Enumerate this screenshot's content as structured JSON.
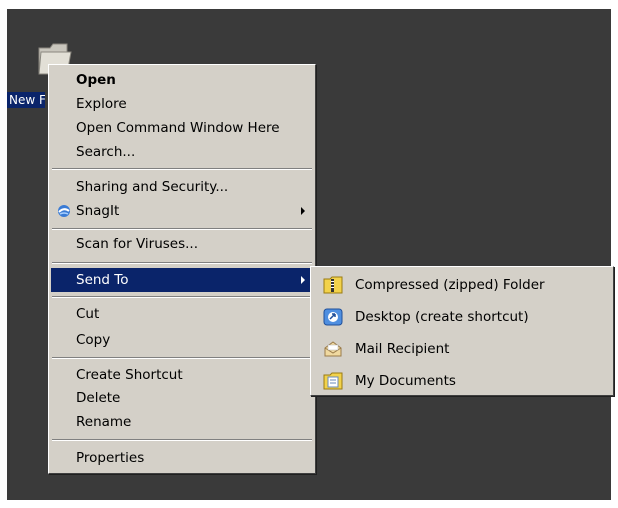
{
  "desktop": {
    "icon_label": "New Folder"
  },
  "context_menu": {
    "items": [
      {
        "label": "Open"
      },
      {
        "label": "Explore"
      },
      {
        "label": "Open Command Window Here"
      },
      {
        "label": "Search..."
      },
      {
        "label": "Sharing and Security..."
      },
      {
        "label": "SnagIt",
        "icon": "snagit-icon",
        "submenu": true
      },
      {
        "label": "Scan for Viruses..."
      },
      {
        "label": "Send To",
        "submenu": true,
        "selected": true
      },
      {
        "label": "Cut"
      },
      {
        "label": "Copy"
      },
      {
        "label": "Create Shortcut"
      },
      {
        "label": "Delete"
      },
      {
        "label": "Rename"
      },
      {
        "label": "Properties"
      }
    ]
  },
  "send_to_menu": {
    "items": [
      {
        "label": "Compressed (zipped) Folder",
        "icon": "zip-folder-icon"
      },
      {
        "label": "Desktop (create shortcut)",
        "icon": "desktop-shortcut-icon"
      },
      {
        "label": "Mail Recipient",
        "icon": "mail-icon"
      },
      {
        "label": "My Documents",
        "icon": "my-documents-icon"
      }
    ]
  },
  "colors": {
    "desktop": "#3a3a3a",
    "menu": "#d4d0c8",
    "highlight": "#0a246a"
  }
}
